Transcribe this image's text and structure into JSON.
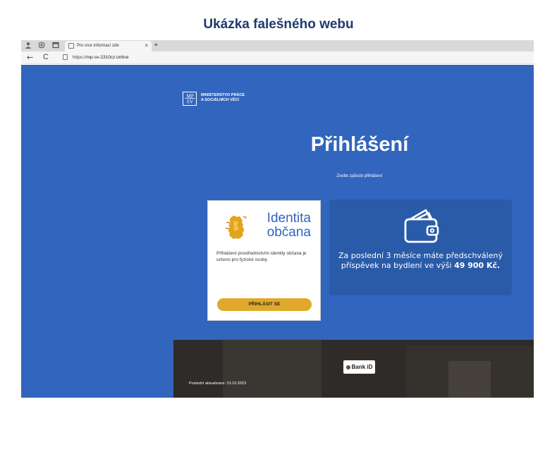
{
  "caption": "Ukázka falešného webu",
  "browser": {
    "tab_title": "Pro více informací zde",
    "tab_close": "×",
    "new_tab": "+",
    "url_scheme": "https://",
    "url_host": "mp-sv-2310cz.online",
    "back": "←",
    "reload": "C"
  },
  "site": {
    "logo_mark": "MP\nSV",
    "logo_text": "MINISTERSTVO PRÁCE\nA SOCIÁLNÍCH VĚCÍ",
    "heading": "Přihlášení",
    "subheading": "Zvolte způsob přihlášení",
    "identity_card": {
      "title": "Identita\nobčana",
      "description": "Přihlášení prostřednictvím identity občana je určeno pro fyzické osoby.",
      "button": "PŘIHLÁSIT SE"
    },
    "offer_card": {
      "text_before": "Za poslední 3 měsíce máte předschválený příspěvek na bydlení ve výši ",
      "amount": "49 900 Kč",
      "text_after": "."
    },
    "footer": {
      "bankid": "Bank iD",
      "updated": "Poslední aktualizace: 23.10.2023"
    }
  },
  "colors": {
    "site_blue": "#3165be",
    "offer_blue": "#2a5ba8",
    "button_gold": "#e0a92b",
    "caption_navy": "#1f3a6e"
  },
  "icons": [
    "user-icon",
    "extensions-icon",
    "tabs-icon",
    "page-icon",
    "lock-icon",
    "wallet-icon",
    "lion-emblem-icon"
  ]
}
